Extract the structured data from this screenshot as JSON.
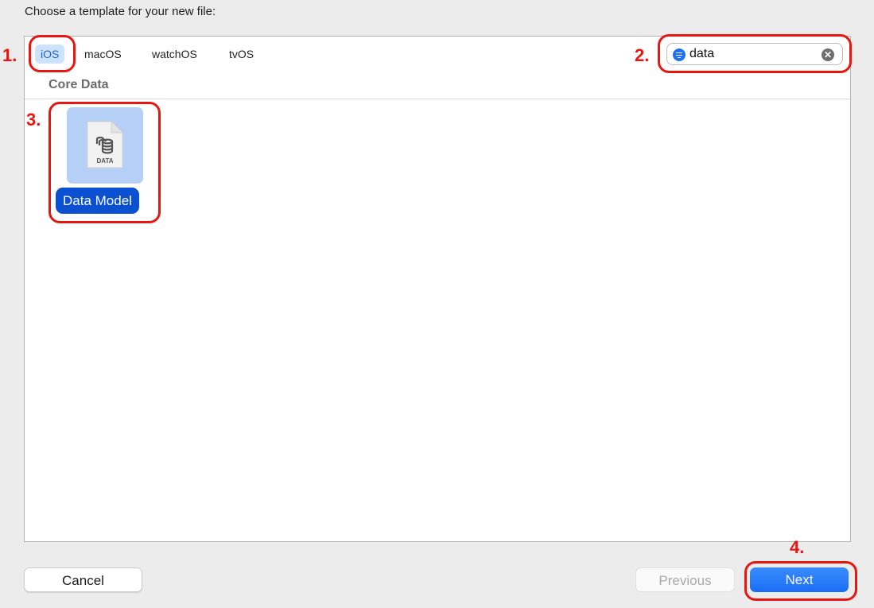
{
  "dialog": {
    "prompt": "Choose a template for your new file:"
  },
  "platform_tabs": [
    {
      "label": "iOS",
      "selected": true
    },
    {
      "label": "macOS",
      "selected": false
    },
    {
      "label": "watchOS",
      "selected": false
    },
    {
      "label": "tvOS",
      "selected": false
    }
  ],
  "search": {
    "value": "data",
    "filter_icon": "filter-icon",
    "clear_icon": "clear-icon",
    "clear_glyph": "✕"
  },
  "section": {
    "title": "Core Data"
  },
  "templates": [
    {
      "label": "Data Model",
      "icon": "data-model-file-icon",
      "icon_text": "DATA",
      "selected": true
    }
  ],
  "buttons": {
    "cancel": "Cancel",
    "previous": "Previous",
    "next": "Next"
  },
  "annotations": {
    "step1": "1.",
    "step2": "2.",
    "step3": "3.",
    "step4": "4.",
    "color": "#e8160f"
  },
  "colors": {
    "accent": "#1a6ef5",
    "selected_tab_bg": "#cfe2fb",
    "selected_label_bg": "#0b50d0"
  }
}
